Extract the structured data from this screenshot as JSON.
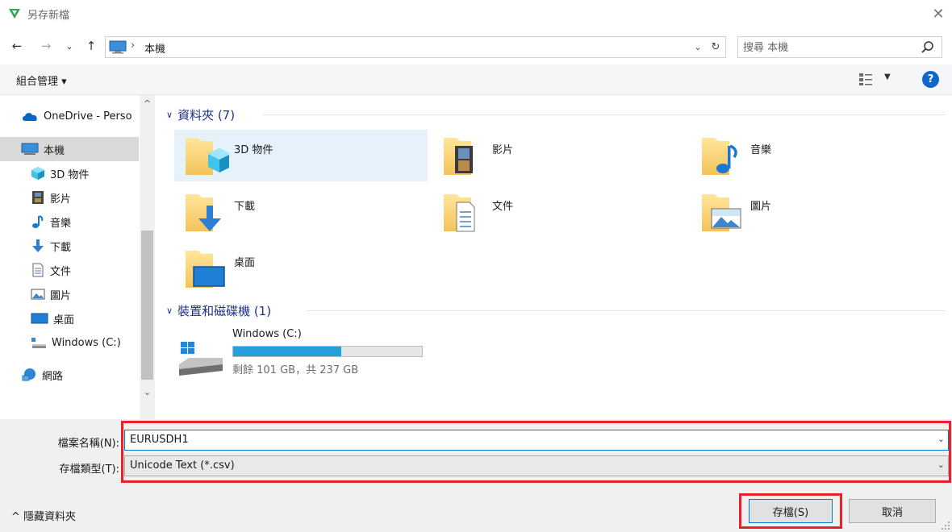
{
  "window": {
    "title": "另存新檔",
    "close_icon": "close-icon"
  },
  "nav": {
    "back": "←",
    "forward": "→",
    "recent": "⌄",
    "up": "↑",
    "breadcrumb_sep": "›",
    "location": "本機",
    "dropdown": "⌄",
    "refresh": "↻"
  },
  "search": {
    "placeholder": "搜尋 本機"
  },
  "toolbar": {
    "organize": "組合管理 ▾",
    "view_dropdown": "▼",
    "help": "?"
  },
  "sidebar": {
    "items": [
      {
        "label": "OneDrive - Perso",
        "icon": "cloud-icon"
      },
      {
        "label": "本機",
        "icon": "computer-icon",
        "selected": true
      },
      {
        "label": "3D 物件",
        "icon": "cube-icon"
      },
      {
        "label": "影片",
        "icon": "film-icon"
      },
      {
        "label": "音樂",
        "icon": "music-icon"
      },
      {
        "label": "下載",
        "icon": "download-icon"
      },
      {
        "label": "文件",
        "icon": "document-icon"
      },
      {
        "label": "圖片",
        "icon": "picture-icon"
      },
      {
        "label": "桌面",
        "icon": "desktop-icon"
      },
      {
        "label": "Windows (C:)",
        "icon": "drive-icon"
      },
      {
        "label": "網路",
        "icon": "network-icon"
      }
    ],
    "scroll_up": "^",
    "scroll_down": "⌄"
  },
  "main": {
    "folders_header": "資料夾 (7)",
    "folders": [
      {
        "label": "3D 物件",
        "icon": "cube-icon",
        "selected": true
      },
      {
        "label": "影片",
        "icon": "film-icon"
      },
      {
        "label": "音樂",
        "icon": "music-icon"
      },
      {
        "label": "下載",
        "icon": "download-icon"
      },
      {
        "label": "文件",
        "icon": "document-icon"
      },
      {
        "label": "圖片",
        "icon": "picture-icon"
      },
      {
        "label": "桌面",
        "icon": "desktop-icon"
      }
    ],
    "devices_header": "裝置和磁碟機 (1)",
    "drive": {
      "name": "Windows (C:)",
      "free_text": "剩餘 101 GB，共 237 GB",
      "used_fraction": 0.574
    }
  },
  "form": {
    "filename_label": "檔案名稱(N):",
    "filename_value": "EURUSDH1",
    "filetype_label": "存檔類型(T):",
    "filetype_value": "Unicode Text (*.csv)",
    "dropdown_arrow": "⌄"
  },
  "footer": {
    "hide_folders": "^  隱藏資料夾",
    "save": "存檔(S)",
    "cancel": "取消"
  },
  "colors": {
    "accent": "#0078d7",
    "highlight": "#e8212a",
    "header": "#1e3287",
    "drive_fill": "#26a0da"
  }
}
